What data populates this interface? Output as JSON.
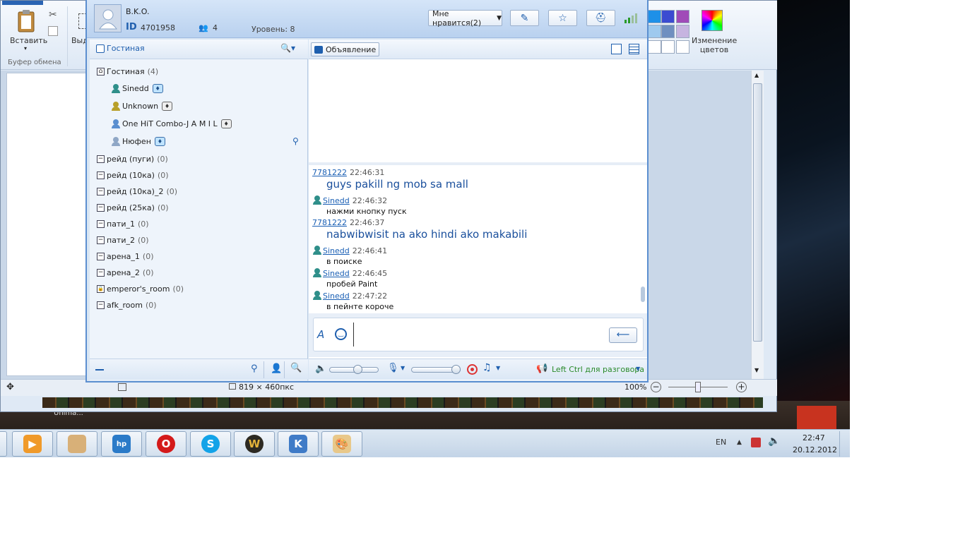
{
  "paint": {
    "paste_label": "Вставить",
    "select_label": "Выд",
    "clipboard_group": "Буфер обмена",
    "edit_colors_label": "Изменение цветов",
    "dimensions": "819 × 460пкс",
    "zoom": "100%",
    "taskbar_peek_text": "Unima..."
  },
  "header": {
    "user_name": "B.K.O.",
    "id_label": "ID",
    "id_value": "4701958",
    "members_count": "4",
    "level_label": "Уровень: 8",
    "like_button": "Мне нравится(2)"
  },
  "left_panel": {
    "room_tab": "Гостиная",
    "rooms": [
      {
        "name": "Гостиная",
        "count": "(4)",
        "icon": "home-icon"
      },
      {
        "name": "рейд (пуги)",
        "count": "(0)"
      },
      {
        "name": "рейд (10ка)",
        "count": "(0)"
      },
      {
        "name": "рейд (10ка)_2",
        "count": "(0)"
      },
      {
        "name": "рейд (25ка)",
        "count": "(0)"
      },
      {
        "name": "пати_1",
        "count": "(0)"
      },
      {
        "name": "пати_2",
        "count": "(0)"
      },
      {
        "name": "арена_1",
        "count": "(0)"
      },
      {
        "name": "арена_2",
        "count": "(0)"
      },
      {
        "name": "emperor's_room",
        "count": "(0)",
        "icon": "lock-icon"
      },
      {
        "name": "afk_room",
        "count": "(0)"
      }
    ],
    "users": [
      {
        "name": "Sinedd",
        "icon_color": "#2f8f8a"
      },
      {
        "name": "Unknown",
        "icon_color": "#b8a02a"
      },
      {
        "name": "One HiT Combo-J A M I L",
        "icon_color": "#5a8fd0"
      },
      {
        "name": "Нюфен",
        "icon_color": "#8fa7c6"
      }
    ]
  },
  "right_panel": {
    "announce_button": "Объявление",
    "messages": [
      {
        "user": "7781222",
        "time": "22:46:31",
        "text": "guys pakill ng mob sa mall",
        "big": true,
        "show_icon": false
      },
      {
        "user": "Sinedd",
        "time": "22:46:32",
        "text": "нажми кнопку пуск",
        "big": false,
        "show_icon": true
      },
      {
        "user": "7781222",
        "time": "22:46:37",
        "text": "nabwibwisit na ako hindi ako makabili",
        "big": true,
        "show_icon": false
      },
      {
        "user": "Sinedd",
        "time": "22:46:41",
        "text": "в поиске",
        "big": false,
        "show_icon": true
      },
      {
        "user": "Sinedd",
        "time": "22:46:45",
        "text": "пробей Paint",
        "big": false,
        "show_icon": true
      },
      {
        "user": "Sinedd",
        "time": "22:47:22",
        "text": "в пейнте короче",
        "big": false,
        "show_icon": true
      }
    ],
    "input_value": "",
    "volume_level": 0.6,
    "mic_level": 1.0,
    "push_to_talk": "Left Ctrl для разговора"
  },
  "taskbar": {
    "language": "EN",
    "time": "22:47",
    "date": "20.12.2012"
  },
  "colors": {
    "accent": "#5c8fd0",
    "link": "#1a5fb4",
    "push_to_talk": "#2a8a2a"
  }
}
